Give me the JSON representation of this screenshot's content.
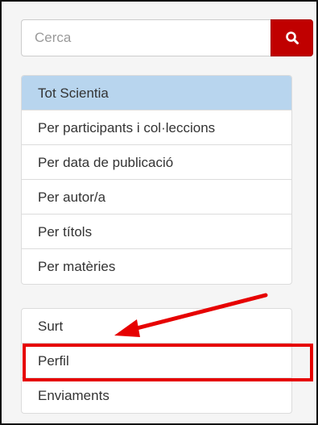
{
  "search": {
    "placeholder": "Cerca",
    "button_icon": "search-icon"
  },
  "browse": {
    "items": [
      {
        "label": "Tot Scientia",
        "active": true
      },
      {
        "label": "Per participants i col·leccions"
      },
      {
        "label": "Per data de publicació"
      },
      {
        "label": "Per autor/a"
      },
      {
        "label": "Per títols"
      },
      {
        "label": "Per matèries"
      }
    ]
  },
  "account": {
    "items": [
      {
        "label": "Surt"
      },
      {
        "label": "Perfil",
        "highlighted": true
      },
      {
        "label": "Enviaments"
      }
    ]
  },
  "colors": {
    "accent": "#c00000",
    "active_background": "#b8d5ee",
    "annotation": "#e60000"
  }
}
